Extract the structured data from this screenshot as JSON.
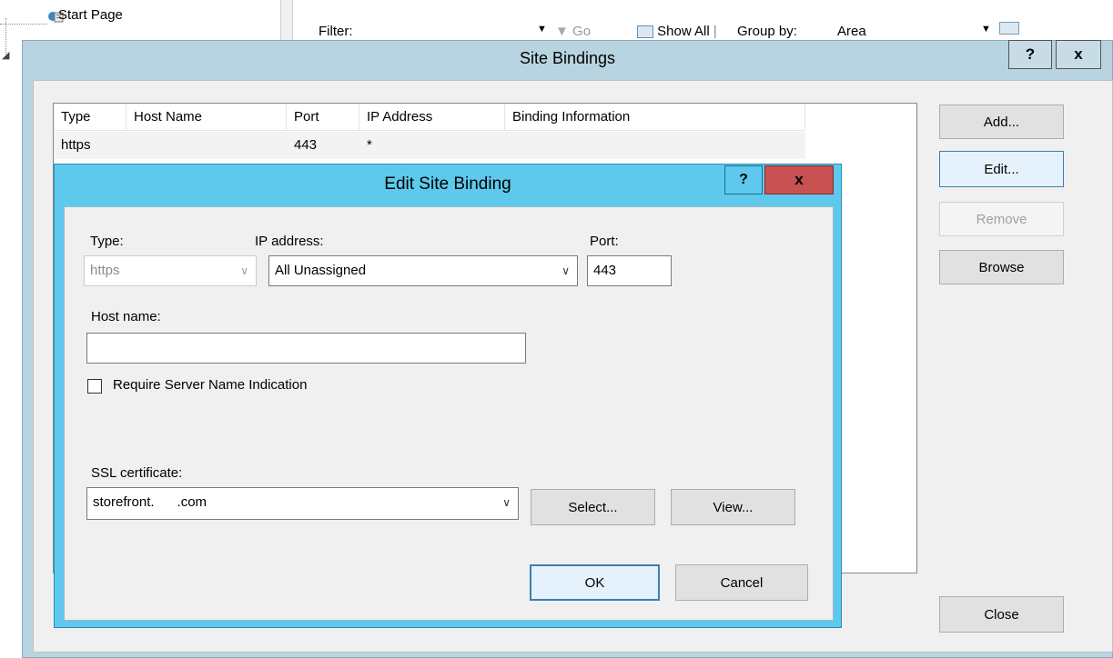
{
  "background": {
    "tree_item": "Start Page",
    "toolbar": {
      "filter_label": "Filter:",
      "go_label": "Go",
      "show_all_label": "Show All",
      "group_by_label": "Group by:",
      "group_by_value": "Area"
    }
  },
  "site_bindings": {
    "title": "Site Bindings",
    "help_label": "?",
    "close_label": "x",
    "columns": [
      "Type",
      "Host Name",
      "Port",
      "IP Address",
      "Binding Information"
    ],
    "rows": [
      {
        "type": "https",
        "host_name": "",
        "port": "443",
        "ip_address": "*",
        "binding_info": ""
      }
    ],
    "buttons": {
      "add": "Add...",
      "edit": "Edit...",
      "remove": "Remove",
      "browse": "Browse",
      "close": "Close"
    }
  },
  "edit_binding": {
    "title": "Edit Site Binding",
    "help_label": "?",
    "close_label": "x",
    "type_label": "Type:",
    "type_value": "https",
    "ip_label": "IP address:",
    "ip_value": "All Unassigned",
    "port_label": "Port:",
    "port_value": "443",
    "host_label": "Host name:",
    "host_value": "",
    "sni_label": "Require Server Name Indication",
    "sni_checked": false,
    "ssl_label": "SSL certificate:",
    "ssl_value": "storefront.      .com",
    "select_button": "Select...",
    "view_button": "View...",
    "ok_button": "OK",
    "cancel_button": "Cancel"
  },
  "colors": {
    "edit_title_bar": "#5ec9ec",
    "close_button_red": "#c75050",
    "site_bindings_frame": "#b9d4e1",
    "dialog_face": "#f0f0f0"
  }
}
